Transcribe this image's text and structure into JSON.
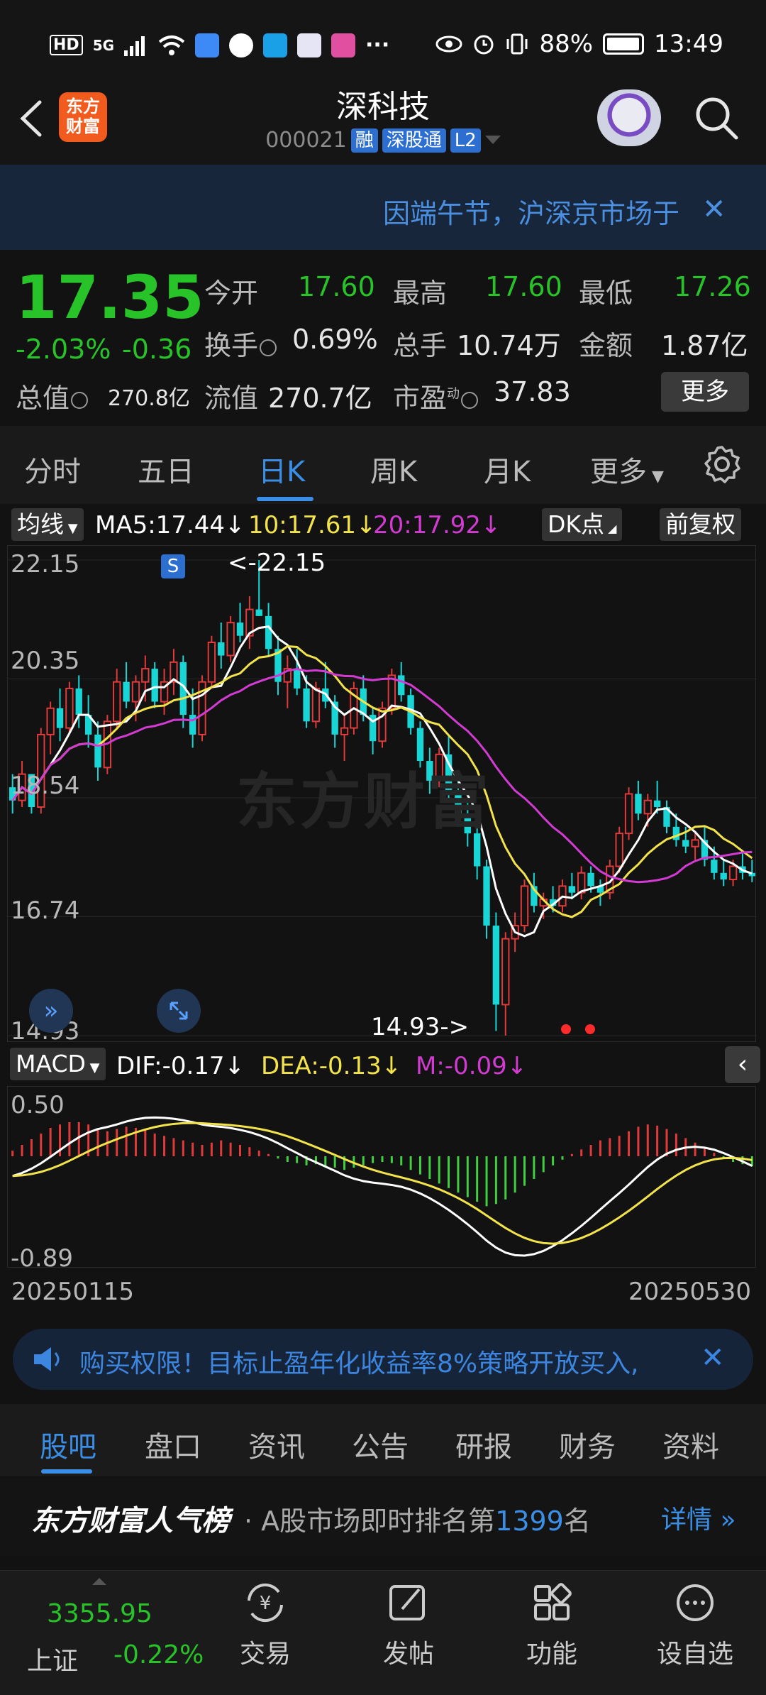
{
  "status_bar": {
    "network_hd": "HD",
    "network_5g": "5G",
    "battery": "88%",
    "time": "13:49",
    "more": "···"
  },
  "header": {
    "logo_text": "东方\n财富",
    "stock_name": "深科技",
    "stock_code": "000021",
    "tags": [
      "融",
      "深股通",
      "L2"
    ]
  },
  "notice": {
    "text": "因端午节，沪深京市场于"
  },
  "quote": {
    "price": "17.35",
    "change_pct": "-2.03%",
    "change_abs": "-0.36",
    "open_label": "今开",
    "open": "17.60",
    "high_label": "最高",
    "high": "17.60",
    "low_label": "最低",
    "low": "17.26",
    "turnover_label": "换手",
    "turnover": "0.69%",
    "volume_label": "总手",
    "volume": "10.74万",
    "amount_label": "金额",
    "amount": "1.87亿",
    "mktcap_label": "总值",
    "mktcap": "270.8亿",
    "float_label": "流值",
    "float": "270.7亿",
    "pe_label": "市盈",
    "pe_sup": "动",
    "pe": "37.83",
    "more": "更多"
  },
  "period_tabs": {
    "items": [
      "分时",
      "五日",
      "日K",
      "周K",
      "月K",
      "更多"
    ],
    "active": "日K"
  },
  "ma_legend": {
    "selector": "均线",
    "ma5": "MA5:17.44↓",
    "ma10": "10:17.61↓",
    "ma20": "20:17.92↓",
    "dk": "DK点",
    "adjust": "前复权"
  },
  "kline": {
    "y_labels": [
      "22.15",
      "20.35",
      "18.54",
      "16.74",
      "14.93"
    ],
    "high_marker": "<-22.15",
    "low_marker": "14.93->",
    "s_marker": "S",
    "watermark": "东方财富",
    "colors": {
      "up": "#e03a3a",
      "down": "#19d6d6",
      "ma5": "#ffffff",
      "ma10": "#f3e34a",
      "ma20": "#d23bd2"
    }
  },
  "macd_legend": {
    "selector": "MACD",
    "dif": "DIF:-0.17↓",
    "dea": "DEA:-0.13↓",
    "m": "M:-0.09↓"
  },
  "macd": {
    "y_top": "0.50",
    "y_bottom": "-0.89"
  },
  "dates": {
    "start": "20250115",
    "end": "20250530"
  },
  "ad": {
    "text": "购买权限！目标止盈年化收益率8%策略开放买入,"
  },
  "bottom_tabs": {
    "items": [
      "股吧",
      "盘口",
      "资讯",
      "公告",
      "研报",
      "财务",
      "资料"
    ],
    "active": "股吧"
  },
  "popularity": {
    "title": "东方财富人气榜",
    "prefix": "· A股市场即时排名第",
    "rank": "1399",
    "suffix": "名",
    "detail": "详情"
  },
  "nav": {
    "index_value": "3355.95",
    "index_name": "上证",
    "index_change": "-0.22%",
    "items": [
      "交易",
      "发帖",
      "功能",
      "设自选"
    ]
  },
  "chart_data": {
    "type": "candlestick",
    "x_start": "20250115",
    "x_end": "20250530",
    "ylim": [
      14.93,
      22.15
    ],
    "candles": [
      [
        18.7,
        18.9,
        18.3,
        18.5
      ],
      [
        18.5,
        19.1,
        18.4,
        18.9
      ],
      [
        18.9,
        18.9,
        18.3,
        18.4
      ],
      [
        18.4,
        19.6,
        18.3,
        19.5
      ],
      [
        19.5,
        20.0,
        19.2,
        19.9
      ],
      [
        19.9,
        20.2,
        19.4,
        19.6
      ],
      [
        19.6,
        20.3,
        19.5,
        20.2
      ],
      [
        20.2,
        20.4,
        19.6,
        19.8
      ],
      [
        19.8,
        20.1,
        19.3,
        19.5
      ],
      [
        19.5,
        19.7,
        18.8,
        19.0
      ],
      [
        19.0,
        19.8,
        18.9,
        19.7
      ],
      [
        19.7,
        20.5,
        19.6,
        20.3
      ],
      [
        20.3,
        20.6,
        19.9,
        20.0
      ],
      [
        20.0,
        20.4,
        19.7,
        20.3
      ],
      [
        20.3,
        20.7,
        20.0,
        20.5
      ],
      [
        20.5,
        20.6,
        19.9,
        20.0
      ],
      [
        20.0,
        20.5,
        19.8,
        20.3
      ],
      [
        20.3,
        20.8,
        20.1,
        20.6
      ],
      [
        20.6,
        20.7,
        19.6,
        19.8
      ],
      [
        19.8,
        20.2,
        19.3,
        19.5
      ],
      [
        19.5,
        20.4,
        19.4,
        20.3
      ],
      [
        20.3,
        21.0,
        20.2,
        20.9
      ],
      [
        20.9,
        21.2,
        20.5,
        20.7
      ],
      [
        20.7,
        21.3,
        20.6,
        21.2
      ],
      [
        21.2,
        21.5,
        20.9,
        21.0
      ],
      [
        21.0,
        21.6,
        20.8,
        21.4
      ],
      [
        21.4,
        22.15,
        21.3,
        21.3
      ],
      [
        21.3,
        21.5,
        20.7,
        20.8
      ],
      [
        20.8,
        21.0,
        20.1,
        20.3
      ],
      [
        20.3,
        20.7,
        19.9,
        20.5
      ],
      [
        20.5,
        20.8,
        20.1,
        20.2
      ],
      [
        20.2,
        20.4,
        19.6,
        19.7
      ],
      [
        19.7,
        20.3,
        19.6,
        20.2
      ],
      [
        20.2,
        20.6,
        19.9,
        20.0
      ],
      [
        20.0,
        20.1,
        19.3,
        19.5
      ],
      [
        19.5,
        19.8,
        19.1,
        19.6
      ],
      [
        19.6,
        20.3,
        19.5,
        20.2
      ],
      [
        20.2,
        20.4,
        19.7,
        19.8
      ],
      [
        19.8,
        19.9,
        19.2,
        19.4
      ],
      [
        19.4,
        20.0,
        19.3,
        19.9
      ],
      [
        19.9,
        20.5,
        19.8,
        20.4
      ],
      [
        20.4,
        20.6,
        20.0,
        20.1
      ],
      [
        20.1,
        20.2,
        19.5,
        19.6
      ],
      [
        19.6,
        19.7,
        19.0,
        19.1
      ],
      [
        19.1,
        19.3,
        18.6,
        18.8
      ],
      [
        18.8,
        19.3,
        18.7,
        19.2
      ],
      [
        19.2,
        19.5,
        18.5,
        18.6
      ],
      [
        18.6,
        18.8,
        18.1,
        18.3
      ],
      [
        18.3,
        18.5,
        17.8,
        18.0
      ],
      [
        18.0,
        18.2,
        17.3,
        17.5
      ],
      [
        17.5,
        17.6,
        16.4,
        16.6
      ],
      [
        16.6,
        16.8,
        15.0,
        15.4
      ],
      [
        15.4,
        16.5,
        14.93,
        16.4
      ],
      [
        16.4,
        16.8,
        16.2,
        16.6
      ],
      [
        16.6,
        17.3,
        16.5,
        17.2
      ],
      [
        17.2,
        17.4,
        16.8,
        16.9
      ],
      [
        16.9,
        17.1,
        16.7,
        17.0
      ],
      [
        17.0,
        17.2,
        16.8,
        16.9
      ],
      [
        16.9,
        17.3,
        16.8,
        17.2
      ],
      [
        17.2,
        17.4,
        17.0,
        17.1
      ],
      [
        17.1,
        17.5,
        17.0,
        17.4
      ],
      [
        17.4,
        17.5,
        17.1,
        17.2
      ],
      [
        17.2,
        17.3,
        16.9,
        17.1
      ],
      [
        17.1,
        17.6,
        17.0,
        17.5
      ],
      [
        17.5,
        18.1,
        17.4,
        18.0
      ],
      [
        18.0,
        18.7,
        17.9,
        18.6
      ],
      [
        18.6,
        18.8,
        18.2,
        18.3
      ],
      [
        18.3,
        18.6,
        18.1,
        18.5
      ],
      [
        18.5,
        18.8,
        18.3,
        18.4
      ],
      [
        18.4,
        18.5,
        18.0,
        18.1
      ],
      [
        18.1,
        18.3,
        17.8,
        17.9
      ],
      [
        17.9,
        18.1,
        17.7,
        17.8
      ],
      [
        17.8,
        18.0,
        17.6,
        17.9
      ],
      [
        17.9,
        18.1,
        17.5,
        17.6
      ],
      [
        17.6,
        17.8,
        17.3,
        17.4
      ],
      [
        17.4,
        17.6,
        17.2,
        17.3
      ],
      [
        17.3,
        17.6,
        17.2,
        17.5
      ],
      [
        17.5,
        17.7,
        17.3,
        17.4
      ],
      [
        17.4,
        17.6,
        17.26,
        17.35
      ]
    ],
    "macd_hist": [
      0.05,
      0.1,
      0.15,
      0.2,
      0.25,
      0.28,
      0.3,
      0.3,
      0.28,
      0.25,
      0.22,
      0.24,
      0.26,
      0.25,
      0.23,
      0.2,
      0.18,
      0.16,
      0.14,
      0.12,
      0.1,
      0.12,
      0.14,
      0.12,
      0.1,
      0.08,
      0.05,
      0.02,
      -0.02,
      -0.05,
      -0.06,
      -0.08,
      -0.07,
      -0.09,
      -0.1,
      -0.12,
      -0.1,
      -0.08,
      -0.06,
      -0.05,
      -0.06,
      -0.08,
      -0.12,
      -0.16,
      -0.2,
      -0.24,
      -0.28,
      -0.32,
      -0.36,
      -0.4,
      -0.44,
      -0.42,
      -0.38,
      -0.32,
      -0.26,
      -0.2,
      -0.14,
      -0.08,
      -0.03,
      0.02,
      0.06,
      0.1,
      0.14,
      0.16,
      0.18,
      0.22,
      0.26,
      0.28,
      0.27,
      0.24,
      0.2,
      0.16,
      0.12,
      0.07,
      0.03,
      -0.02,
      -0.05,
      -0.07,
      -0.09
    ]
  }
}
